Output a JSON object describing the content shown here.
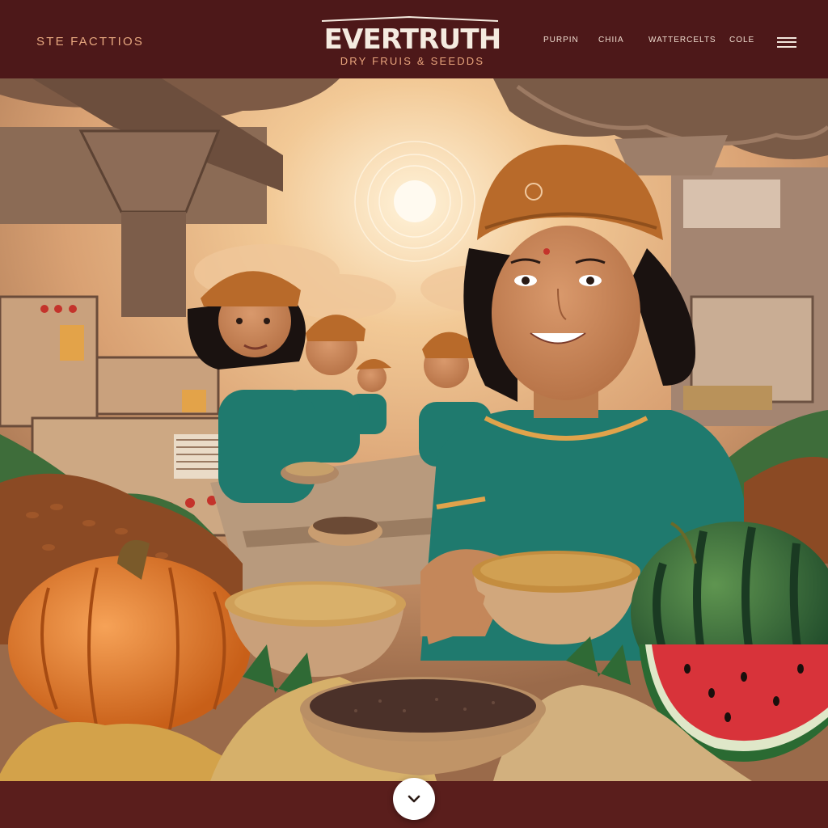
{
  "header": {
    "nav_left": "STE FACTTIOS",
    "brand_title": "EVERTRUTH",
    "brand_subtitle": "DRY FRUIS & SEEDDS",
    "nav_links": [
      "PURPIN",
      "CHIIA",
      "WATTERCELTS",
      "COLE"
    ],
    "menu_icon": "hamburger-icon"
  },
  "hero": {
    "scene_description_icons": [
      "sun-icon",
      "pumpkin-icon",
      "watermelon-icon",
      "seed-bowl-icon",
      "factory-machine-icon",
      "worker-figure-icon"
    ]
  },
  "scroll": {
    "icon": "chevron-down-icon"
  },
  "colors": {
    "header_bg": "#4d1819",
    "accent": "#e6a77f",
    "brand_text": "#f5ebe0",
    "teal_uniform": "#1f7a6e",
    "headscarf": "#b86a2a"
  }
}
